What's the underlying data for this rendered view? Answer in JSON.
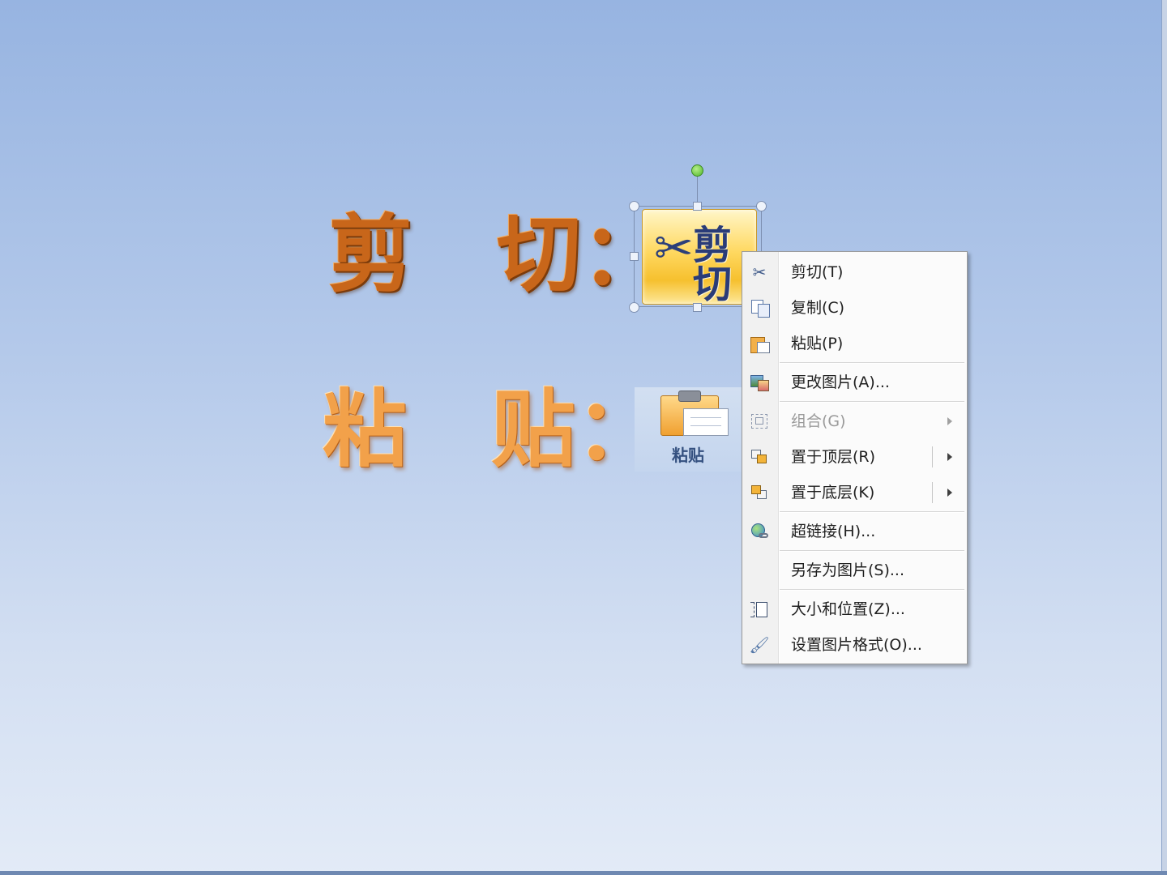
{
  "slide": {
    "cut_title": "剪　切：",
    "paste_title": "粘　贴：",
    "cut_picture_label": "剪切",
    "paste_picture_label": "粘贴"
  },
  "context_menu": {
    "items": [
      {
        "label": "剪切(T)",
        "icon": "scissors-icon",
        "disabled": false,
        "submenu": false
      },
      {
        "label": "复制(C)",
        "icon": "copy-icon",
        "disabled": false,
        "submenu": false
      },
      {
        "label": "粘贴(P)",
        "icon": "paste-icon",
        "disabled": false,
        "submenu": false
      },
      {
        "label": "更改图片(A)...",
        "icon": "change-picture-icon",
        "disabled": false,
        "submenu": false
      },
      {
        "label": "组合(G)",
        "icon": "group-icon",
        "disabled": true,
        "submenu": true
      },
      {
        "label": "置于顶层(R)",
        "icon": "bring-to-front-icon",
        "disabled": false,
        "submenu": true
      },
      {
        "label": "置于底层(K)",
        "icon": "send-to-back-icon",
        "disabled": false,
        "submenu": true
      },
      {
        "label": "超链接(H)...",
        "icon": "hyperlink-icon",
        "disabled": false,
        "submenu": false
      },
      {
        "label": "另存为图片(S)...",
        "icon": "",
        "disabled": false,
        "submenu": false
      },
      {
        "label": "大小和位置(Z)...",
        "icon": "size-position-icon",
        "disabled": false,
        "submenu": false
      },
      {
        "label": "设置图片格式(O)...",
        "icon": "format-picture-icon",
        "disabled": false,
        "submenu": false
      }
    ]
  },
  "colors": {
    "cut_title": "#c8661a",
    "paste_title": "#f2a14a",
    "background_top": "#97b4e1",
    "background_bottom": "#e3ebf7"
  }
}
